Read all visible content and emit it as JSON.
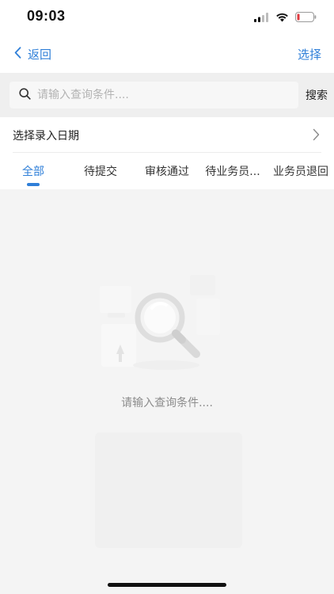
{
  "status_bar": {
    "time": "09:03",
    "icons": [
      "signal-icon",
      "wifi-icon",
      "battery-low-icon"
    ],
    "battery_color": "#e0393e"
  },
  "nav": {
    "back_label": "返回",
    "select_label": "选择",
    "accent_color": "#2f7fd8"
  },
  "search": {
    "placeholder": "请输入查询条件....",
    "button_label": "搜索"
  },
  "date_filter": {
    "label": "选择录入日期"
  },
  "tabs": [
    {
      "label": "全部",
      "active": true
    },
    {
      "label": "待提交",
      "active": false
    },
    {
      "label": "审核通过",
      "active": false
    },
    {
      "label": "待业务员...",
      "active": false
    },
    {
      "label": "业务员退回",
      "active": false
    }
  ],
  "empty_state": {
    "message": "请输入查询条件...."
  }
}
